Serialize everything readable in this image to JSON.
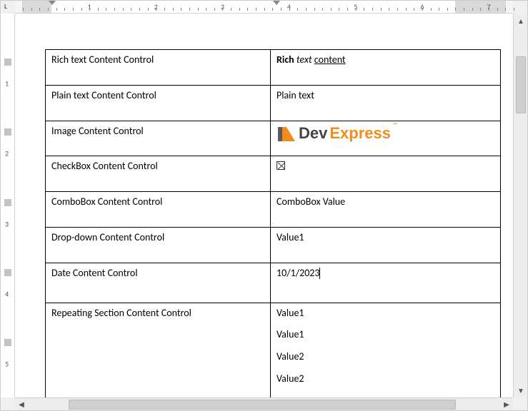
{
  "ruler": {
    "top_numbers": [
      "1",
      "2",
      "3",
      "4",
      "5",
      "6",
      "7"
    ],
    "left_numbers": [
      "1",
      "2",
      "3",
      "4",
      "5"
    ]
  },
  "table": {
    "rows": [
      {
        "label": "Rich text Content Control"
      },
      {
        "label": "Plain text Content Control"
      },
      {
        "label": "Image Content Control"
      },
      {
        "label": "CheckBox Content Control"
      },
      {
        "label": "ComboBox Content Control"
      },
      {
        "label": "Drop-down Content Control"
      },
      {
        "label": "Date Content Control"
      },
      {
        "label": "Repeating Section Content Control"
      }
    ]
  },
  "values": {
    "rich_text": {
      "part1": "Rich",
      "part2": "text",
      "part3": "content"
    },
    "plain_text": "Plain text",
    "image_logo": {
      "dev": "Dev",
      "express": "Express",
      "tm": "™"
    },
    "combobox": "ComboBox Value",
    "dropdown": "Value1",
    "date": "10/1/2023",
    "repeating": [
      "Value1",
      "Value1",
      "Value2",
      "Value2"
    ]
  }
}
